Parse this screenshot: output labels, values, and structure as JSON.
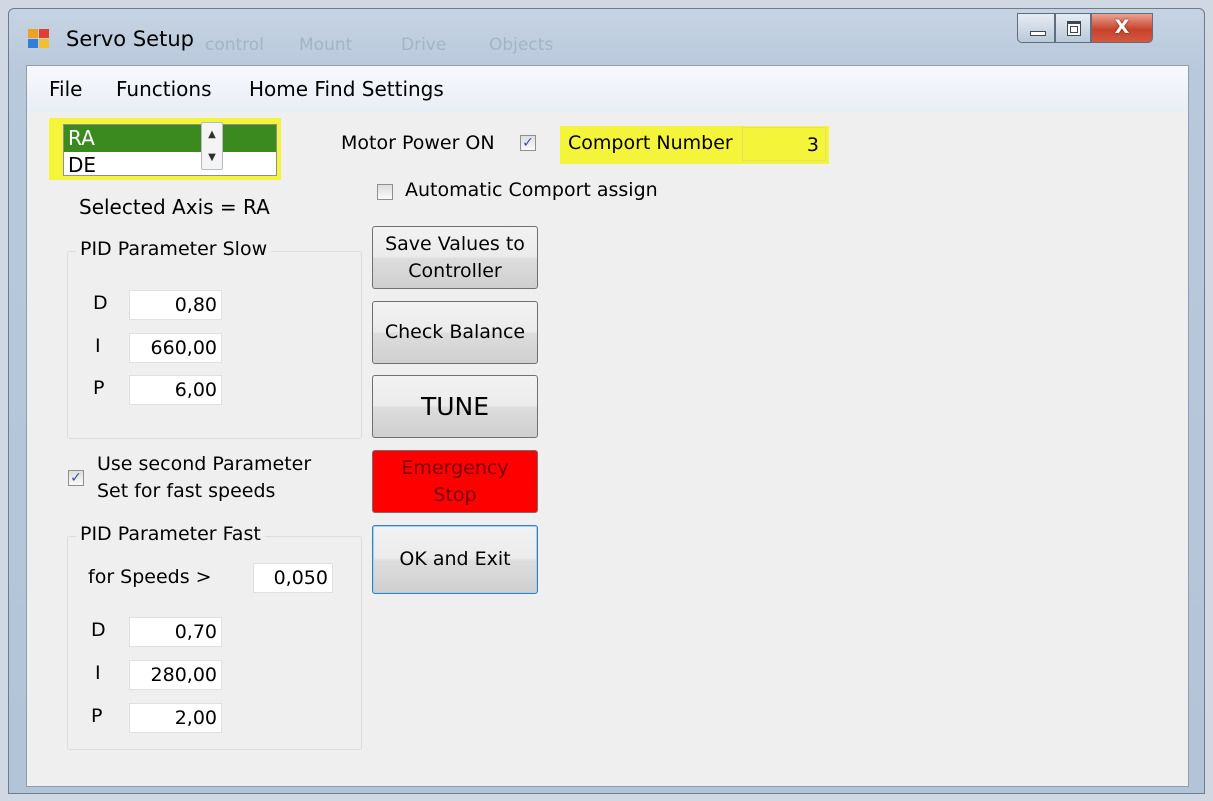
{
  "window": {
    "title": "Servo Setup",
    "background_menu_ghost": [
      "control",
      "Mount",
      "Drive",
      "Objects"
    ],
    "close_symbol": "X"
  },
  "menu": [
    "File",
    "Functions",
    "Home Find Settings"
  ],
  "axis_list": {
    "items": [
      "RA",
      "DE"
    ],
    "selected": "RA",
    "selected_label": "Selected Axis = RA"
  },
  "motor_power": {
    "label": "Motor Power ON",
    "checked": true
  },
  "comport": {
    "label": "Comport Number",
    "value": "3",
    "highlight_color": "#f4f43a"
  },
  "auto_comport": {
    "label": "Automatic Comport assign",
    "checked": false
  },
  "pid_slow": {
    "title": "PID Parameter Slow",
    "D": {
      "label": "D",
      "value": "0,80"
    },
    "I": {
      "label": "I",
      "value": "660,00"
    },
    "P": {
      "label": "P",
      "value": "6,00"
    }
  },
  "second_param": {
    "line1": "Use second Parameter",
    "line2": "Set for fast speeds",
    "checked": true
  },
  "pid_fast": {
    "title": "PID Parameter Fast",
    "speed_label": "for Speeds >",
    "speed_value": "0,050",
    "D": {
      "label": "D",
      "value": "0,70"
    },
    "I": {
      "label": "I",
      "value": "280,00"
    },
    "P": {
      "label": "P",
      "value": "2,00"
    }
  },
  "buttons": {
    "save_line1": "Save Values to",
    "save_line2": "Controller",
    "check_balance": "Check Balance",
    "tune": "TUNE",
    "estop_line1": "Emergency",
    "estop_line2": "Stop",
    "ok_exit": "OK and Exit"
  },
  "colors": {
    "estop": "#ff0000",
    "selection": "#3b8a1f",
    "highlight": "#f4f43a"
  }
}
